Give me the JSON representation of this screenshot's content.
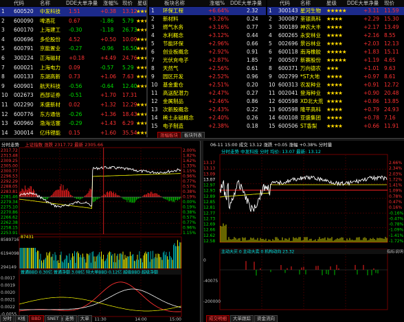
{
  "colors": {
    "up": "#ff3232",
    "down": "#00e000",
    "flat": "#e8e8e8",
    "accent": "#ffff00",
    "bg": "#000000"
  },
  "stock_list": {
    "headers": [
      "代码",
      "名称",
      "DDE大单净量",
      "涨幅%",
      "现价",
      "星级"
    ],
    "rows": [
      {
        "idx": "1",
        "code": "600520",
        "name": "中发科技",
        "dde": "1.51",
        "chg": "+0.38",
        "price": "13.12",
        "stars": 3,
        "selected": true
      },
      {
        "idx": "2",
        "code": "600090",
        "name": "啤酒花",
        "dde": "0.67",
        "chg": "-1.86",
        "price": "5.79",
        "stars": 3
      },
      {
        "idx": "3",
        "code": "600170",
        "name": "上海建工",
        "dde": "-0.30",
        "chg": "-1.18",
        "price": "26.73",
        "stars": 3
      },
      {
        "idx": "4",
        "code": "600696",
        "name": "多伦股份",
        "dde": "4.52",
        "chg": "+0.50",
        "price": "10.09",
        "stars": 3
      },
      {
        "idx": "5",
        "code": "600791",
        "name": "京能置业",
        "dde": "-0.27",
        "chg": "-0.96",
        "price": "16.50",
        "stars": 3
      },
      {
        "idx": "6",
        "code": "300224",
        "name": "正海磁材",
        "dde": "+0.18",
        "chg": "+4.49",
        "price": "24.76",
        "stars": 3
      },
      {
        "idx": "7",
        "code": "600021",
        "name": "上海电力",
        "dde": "0.09",
        "chg": "-0.57",
        "price": "5.29",
        "stars": 3
      },
      {
        "idx": "8",
        "code": "600133",
        "name": "东湖高新",
        "dde": "0.73",
        "chg": "+1.06",
        "price": "7.63",
        "stars": 3
      },
      {
        "idx": "9",
        "code": "600901",
        "name": "航天科技",
        "dde": "-0.56",
        "chg": "-0.64",
        "price": "12.40",
        "stars": 3
      },
      {
        "idx": "10",
        "code": "002673",
        "name": "西部证券",
        "dde": "-0.51",
        "chg": "+1.70",
        "price": "17.31",
        "stars": 0
      },
      {
        "idx": "11",
        "code": "002290",
        "name": "禾盛新材",
        "dde": "0.02",
        "chg": "+1.32",
        "price": "12.29",
        "stars": 3
      },
      {
        "idx": "12",
        "code": "600776",
        "name": "东方通信",
        "dde": "-0.26",
        "chg": "+1.36",
        "price": "18.43",
        "stars": 3
      },
      {
        "idx": "13",
        "code": "600960",
        "name": "渤海活塞",
        "dde": "-0.29",
        "chg": "+1.43",
        "price": "6.29",
        "stars": 3
      },
      {
        "idx": "14",
        "code": "300014",
        "name": "亿纬锂能",
        "dde": "0.15",
        "chg": "+1.60",
        "price": "35.54",
        "stars": 3
      }
    ]
  },
  "sector_list": {
    "headers": [
      "板块名称",
      "涨幅%",
      "DDE大单净量"
    ],
    "rows": [
      {
        "idx": "1",
        "name": "环保工程",
        "chg": "+6.64%",
        "dde": "2.32",
        "selected": true
      },
      {
        "idx": "2",
        "name": "新材料",
        "chg": "+3.26%",
        "dde": "0.24"
      },
      {
        "idx": "3",
        "name": "燃气水务",
        "chg": "+3.16%",
        "dde": "0.77"
      },
      {
        "idx": "4",
        "name": "水利概念",
        "chg": "+3.12%",
        "dde": "0.44"
      },
      {
        "idx": "5",
        "name": "节能环保",
        "chg": "+2.96%",
        "dde": "0.66"
      },
      {
        "idx": "6",
        "name": "创业板概念",
        "chg": "+2.92%",
        "dde": "0.91"
      },
      {
        "idx": "7",
        "name": "光伏充电子",
        "chg": "+2.87%",
        "dde": "1.85"
      },
      {
        "idx": "8",
        "name": "天然气",
        "chg": "+2.56%",
        "dde": "0.61"
      },
      {
        "idx": "9",
        "name": "园区开发",
        "chg": "+2.52%",
        "dde": "0.96"
      },
      {
        "idx": "10",
        "name": "基金重仓",
        "chg": "+2.51%",
        "dde": "0.20"
      },
      {
        "idx": "11",
        "name": "高送配潜力",
        "chg": "+2.47%",
        "dde": "0.27"
      },
      {
        "idx": "12",
        "name": "金属制品",
        "chg": "+2.46%",
        "dde": "0.86"
      },
      {
        "idx": "13",
        "name": "次新股概念",
        "chg": "+2.43%",
        "dde": "0.22"
      },
      {
        "idx": "14",
        "name": "稀土永磁概念",
        "chg": "+2.40%",
        "dde": "0.26"
      },
      {
        "idx": "15",
        "name": "电子制造",
        "chg": "+2.38%",
        "dde": "0.18"
      }
    ]
  },
  "sector_stocks": {
    "headers": [
      "代码",
      "名称",
      "星级",
      "DDE大单净量",
      "现价"
    ],
    "rows": [
      {
        "idx": "1",
        "code": "300143",
        "name": "星河生物",
        "stars": 5,
        "dde": "+3.11",
        "price": "11.59",
        "selected": true
      },
      {
        "idx": "2",
        "code": "300087",
        "name": "荃银高科",
        "stars": 4,
        "dde": "+2.29",
        "price": "15.30"
      },
      {
        "idx": "3",
        "code": "300189",
        "name": "神农大丰",
        "stars": 4,
        "dde": "+2.17",
        "price": "13.49"
      },
      {
        "idx": "4",
        "code": "600265",
        "name": "永安林业",
        "stars": 4,
        "dde": "+2.16",
        "price": "8.55"
      },
      {
        "idx": "5",
        "code": "002696",
        "name": "景谷林业",
        "stars": 4,
        "dde": "+2.03",
        "price": "12.13"
      },
      {
        "idx": "6",
        "code": "600118",
        "name": "南海橡胶",
        "stars": 5,
        "dde": "+1.83",
        "price": "15.11"
      },
      {
        "idx": "7",
        "code": "000507",
        "name": "新赛股份",
        "stars": 5,
        "dde": "+1.19",
        "price": "4.65"
      },
      {
        "idx": "8",
        "code": "600371",
        "name": "万向德农",
        "stars": 3,
        "dde": "+1.01",
        "price": "9.63"
      },
      {
        "idx": "9",
        "code": "002799",
        "name": "*ST大地",
        "stars": 4,
        "dde": "+0.97",
        "price": "8.61"
      },
      {
        "idx": "10",
        "code": "600313",
        "name": "农发种业",
        "stars": 4,
        "dde": "+0.91",
        "price": "12.72"
      },
      {
        "idx": "11",
        "code": "002041",
        "name": "登海种业",
        "stars": 4,
        "dde": "+0.90",
        "price": "20.48"
      },
      {
        "idx": "12",
        "code": "600598",
        "name": "XD北大荒",
        "stars": 4,
        "dde": "+0.86",
        "price": "13.85"
      },
      {
        "idx": "13",
        "code": "600598",
        "name": "隆平高科",
        "stars": 4,
        "dde": "+0.79",
        "price": "24.93"
      },
      {
        "idx": "14",
        "code": "600108",
        "name": "亚盛集团",
        "stars": 4,
        "dde": "+0.78",
        "price": "7.16"
      },
      {
        "idx": "15",
        "code": "600506",
        "name": "ST香梨",
        "stars": 4,
        "dde": "+0.66",
        "price": "11.91"
      }
    ]
  },
  "mid_tabs": [
    "涨幅板块",
    "板块列表"
  ],
  "index_chart": {
    "title": "分时走势",
    "info": "上证指数 涨跌 2317.72 最新 2305.66",
    "y_labels": [
      "2317.72",
      "2313.48",
      "2309.25",
      "2305.00",
      "2300.77",
      "2296.53",
      "2292.29",
      "2288.05",
      "2283.81",
      "2281.46",
      "2279.34",
      "2275.10",
      "2270.86",
      "2266.62",
      "2262.38",
      "2258.15",
      "2253.91"
    ],
    "pct_labels": [
      "2.00%",
      "1.82%",
      "1.62%",
      "1.33%",
      "1.15%",
      "0.96%",
      "0.77%",
      "0.57%",
      "0.38%",
      "0.19%",
      "0.00%",
      "0.19%",
      "0.38%",
      "0.57%",
      "0.77%",
      "0.96%",
      "1.15%"
    ],
    "vol_labels": [
      "8589716",
      "6194098",
      "294149"
    ],
    "vol_value": "87431",
    "indicator_legend": "普通BBD 0.30亿 普通净额 3.08亿 特大单BBD 0.12亿 超级BBD 超级净额",
    "ind_labels": [
      "0.0017",
      "0.0019",
      "0.0020",
      "0.0021",
      "0.0022",
      "-0.0055"
    ],
    "times": [
      "9:30",
      "10:30",
      "11:30",
      "14:00",
      "15:00"
    ],
    "tabs": [
      "分时",
      "K线",
      "BBD",
      "SNET",
      "走势",
      "大单",
      ""
    ]
  },
  "stock_chart": {
    "info": "06-11 15:00 成交 13.12 涨跌 +0.05 涨幅 +0.38% 分时量",
    "title2": "分时走势 中发科技 分时 均价: 13.07 最新: 13.12",
    "y_labels": [
      "13.17",
      "13.13",
      "13.09",
      "13.07",
      "12.97",
      "12.93",
      "12.89",
      "12.85",
      "12.81",
      "12.77",
      "12.73",
      "12.69",
      "12.66",
      "12.62",
      "12.58"
    ],
    "pct_labels": [
      "2.66%",
      "2.34%",
      "2.03%",
      "1.72%",
      "1.41%",
      "1.09%",
      "0.78%",
      "0.47%",
      "0.16%",
      "-0.16%",
      "-0.47%",
      "-0.78%",
      "-1.09%",
      "-1.41%",
      "-1.72%"
    ],
    "indicator_legend": "主动大买 0 主动大卖 0 机构动向 23.32",
    "sub_y": [
      "0",
      "-40075",
      "-200000"
    ],
    "tabs": [
      "成交明细",
      "大单跟踪",
      "资金流向"
    ],
    "right_label": "指标说明"
  }
}
